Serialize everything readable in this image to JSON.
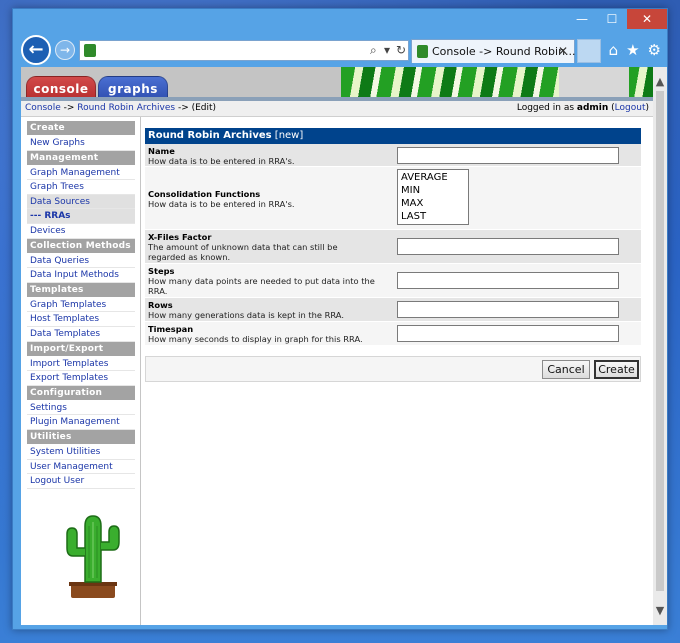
{
  "browser": {
    "tab_title": "Console -> Round Robin...",
    "tab_close": "✕",
    "address_controls": [
      "⌕",
      "▾",
      "↻"
    ],
    "win_controls": [
      "—",
      "☐",
      "✕"
    ],
    "toolbar_icons": [
      "⌂",
      "★",
      "⚙"
    ],
    "back": "←",
    "forward": "→"
  },
  "header": {
    "tab_console": "console",
    "tab_graphs": "graphs"
  },
  "breadcrumb": {
    "console": "Console",
    "sep1": " -> ",
    "rra": "Round Robin Archives",
    "sep2": " -> (Edit)"
  },
  "login": {
    "prefix": "Logged in as ",
    "user": "admin",
    "open": " (",
    "logout": "Logout",
    "close": ")"
  },
  "menu": {
    "create_head": "Create",
    "new_graphs": "New Graphs",
    "management_head": "Management",
    "graph_management": "Graph Management",
    "graph_trees": "Graph Trees",
    "data_sources": "Data Sources",
    "rras": "--- RRAs",
    "devices": "Devices",
    "collection_head": "Collection Methods",
    "data_queries": "Data Queries",
    "data_input_methods": "Data Input Methods",
    "templates_head": "Templates",
    "graph_templates": "Graph Templates",
    "host_templates": "Host Templates",
    "data_templates": "Data Templates",
    "import_export_head": "Import/Export",
    "import_templates": "Import Templates",
    "export_templates": "Export Templates",
    "configuration_head": "Configuration",
    "settings": "Settings",
    "plugin_management": "Plugin Management",
    "utilities_head": "Utilities",
    "system_utilities": "System Utilities",
    "user_management": "User Management",
    "logout_user": "Logout User"
  },
  "form": {
    "title": "Round Robin Archives",
    "title_tag": " [new]",
    "name_title": "Name",
    "name_desc": "How data is to be entered in RRA's.",
    "cf_title": "Consolidation Functions",
    "cf_desc": "How data is to be entered in RRA's.",
    "cf_options": [
      "AVERAGE",
      "MIN",
      "MAX",
      "LAST"
    ],
    "xff_title": "X-Files Factor",
    "xff_desc": "The amount of unknown data that can still be regarded as known.",
    "steps_title": "Steps",
    "steps_desc": "How many data points are needed to put data into the RRA.",
    "rows_title": "Rows",
    "rows_desc": "How many generations data is kept in the RRA.",
    "timespan_title": "Timespan",
    "timespan_desc": "How many seconds to display in graph for this RRA.",
    "cancel": "Cancel",
    "create": "Create"
  },
  "colors": {
    "form_header": "#00438c",
    "menu_header": "#a3a3a3",
    "link": "#1b36a8",
    "console_tab": "#c23a3a",
    "graphs_tab": "#3a5cc2"
  }
}
